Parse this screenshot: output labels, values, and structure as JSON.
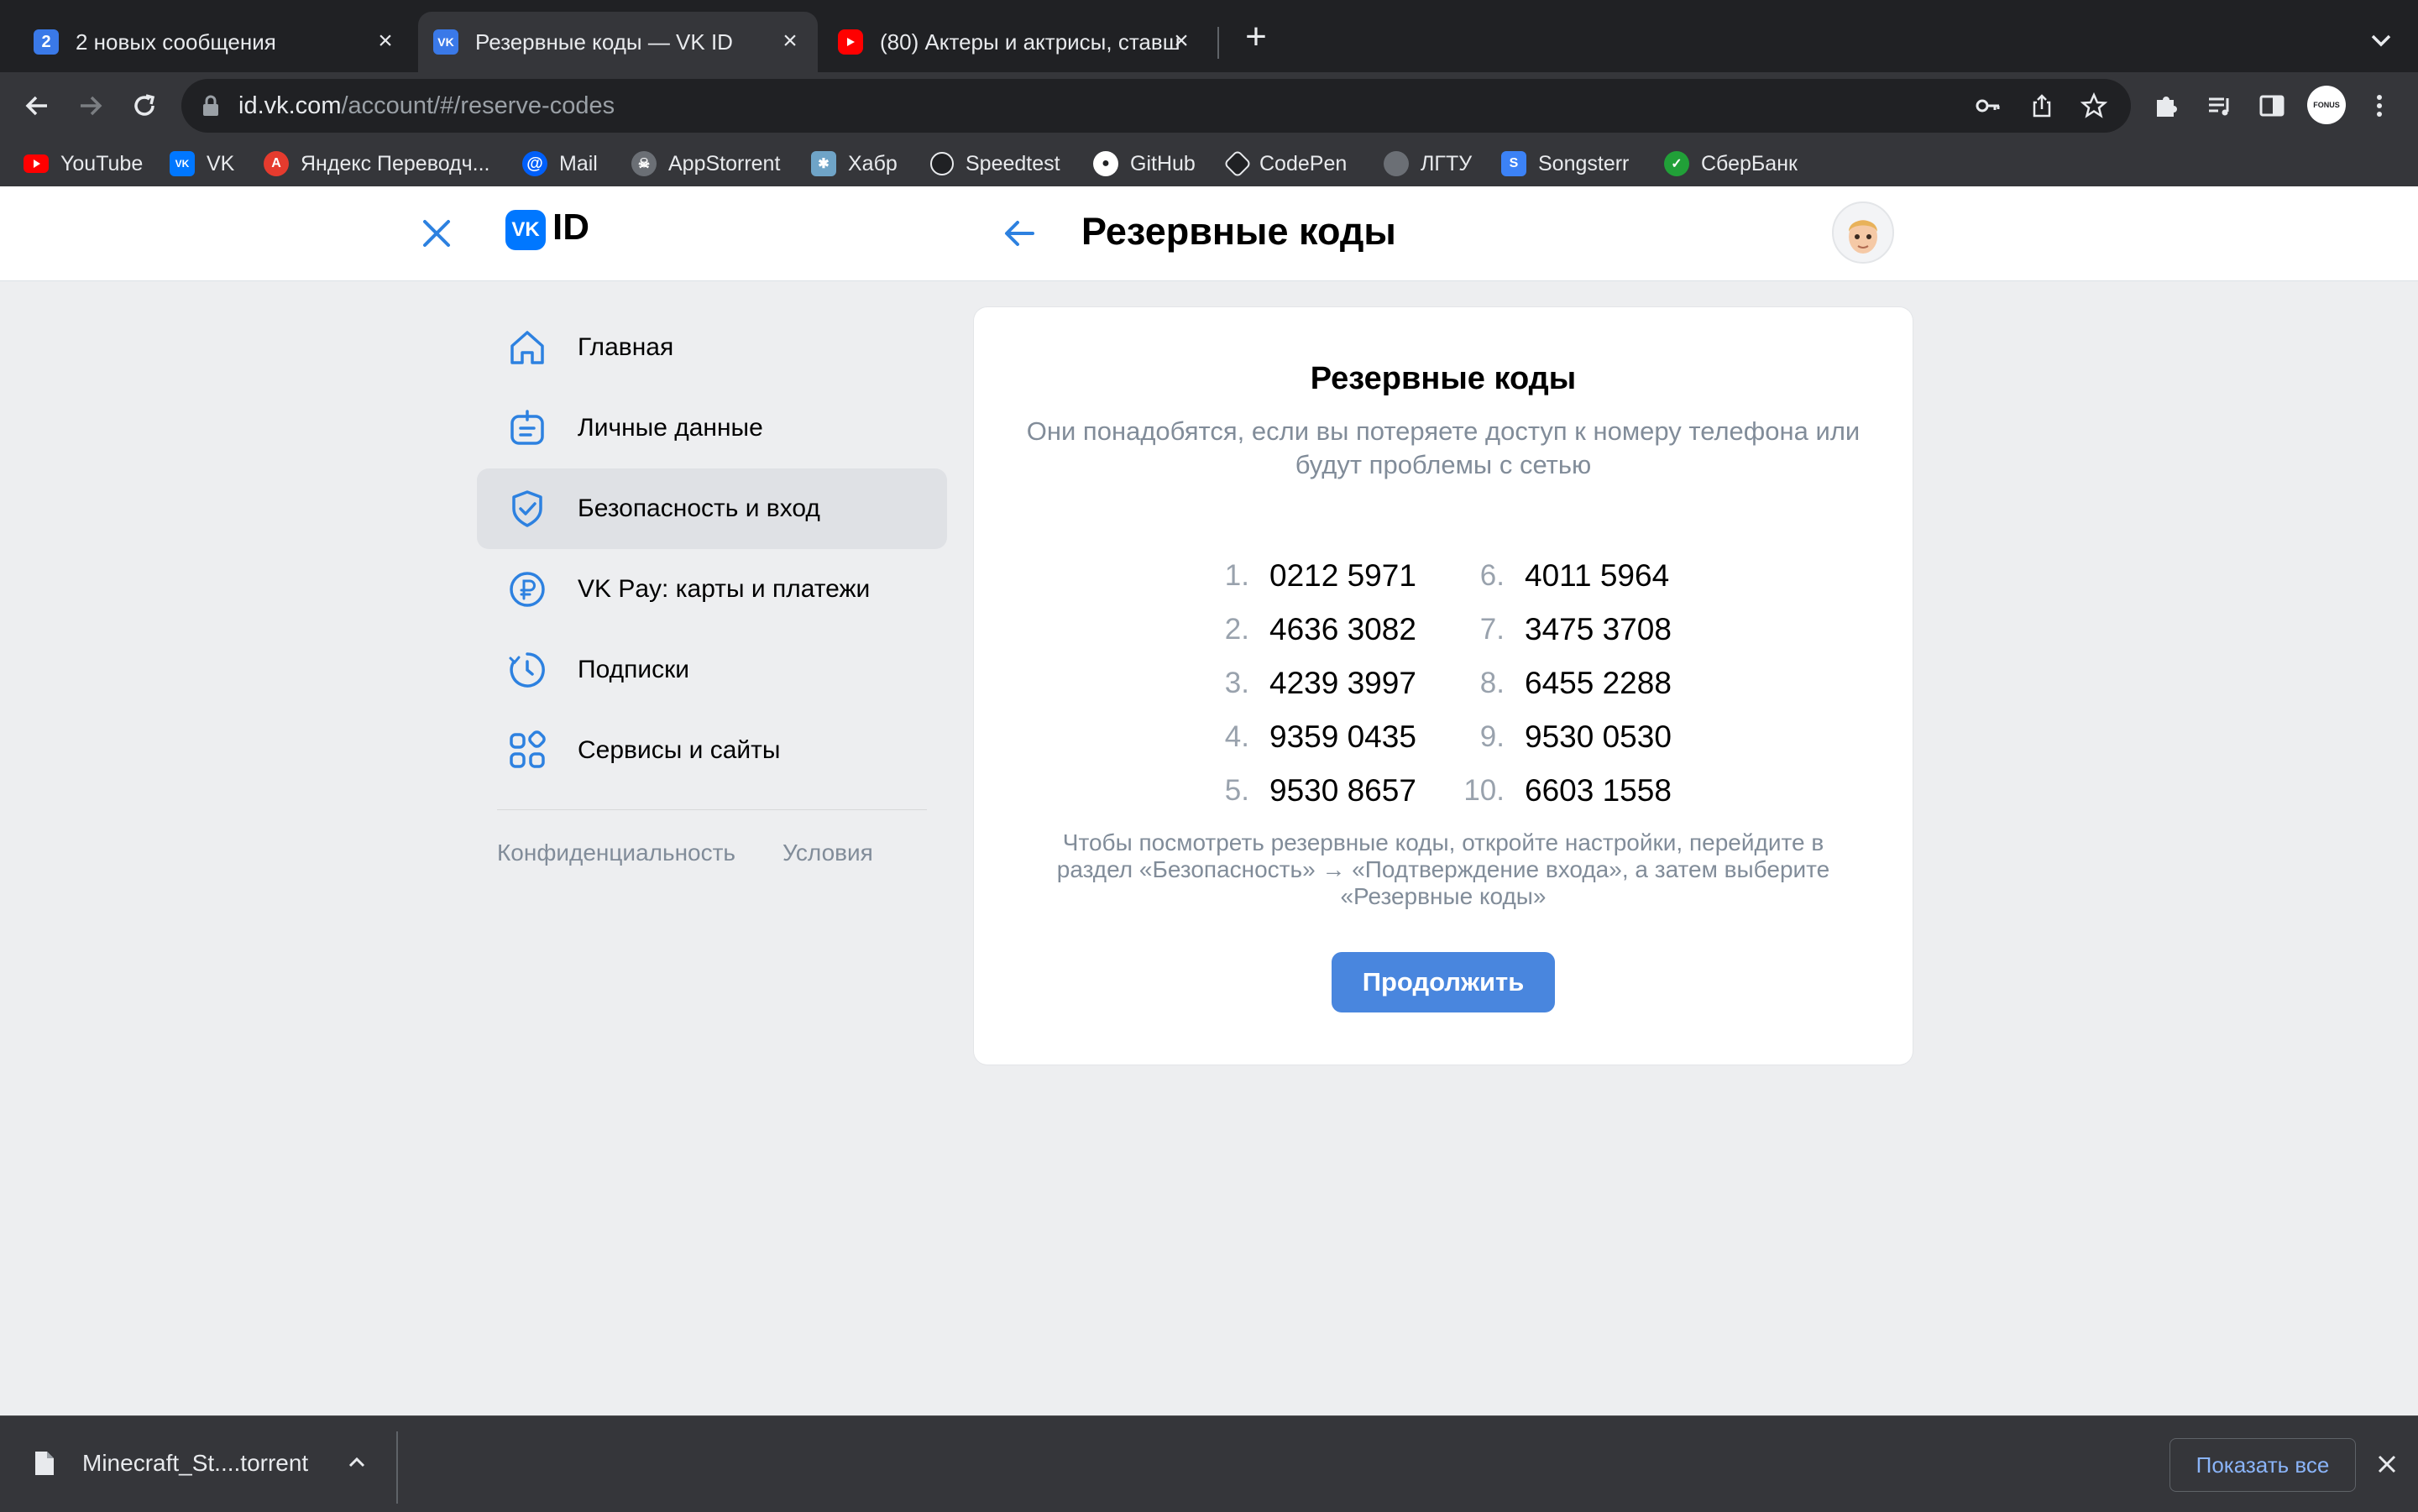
{
  "browser": {
    "tabs": [
      {
        "favicon": "2",
        "title": "2 новых сообщения"
      },
      {
        "favicon": "vk-logo-icon",
        "title": "Резервные коды — VK ID"
      },
      {
        "favicon": "youtube-icon",
        "title": "(80) Актеры и актрисы, ставш"
      }
    ],
    "new_tab": "+",
    "url_host": "id.vk.com",
    "url_path": "/account/#/reserve-codes",
    "profile_label": "FONUS",
    "bookmarks": [
      {
        "label": "YouTube",
        "icon": "youtube-icon",
        "color": "#ff0000"
      },
      {
        "label": "VK",
        "icon": "vk-icon",
        "color": "#0077ff"
      },
      {
        "label": "Яндекс Переводч...",
        "icon": "yandex-translate-icon",
        "color": "#e63b2e"
      },
      {
        "label": "Mail",
        "icon": "mail-icon",
        "color": "#005ff9"
      },
      {
        "label": "AppStorrent",
        "icon": "appstorrent-icon",
        "color": "#6b6f75"
      },
      {
        "label": "Хабр",
        "icon": "habr-icon",
        "color": "#6fa4c7"
      },
      {
        "label": "Speedtest",
        "icon": "speedtest-icon",
        "color": "#202124"
      },
      {
        "label": "GitHub",
        "icon": "github-icon",
        "color": "#ffffff"
      },
      {
        "label": "CodePen",
        "icon": "codepen-icon",
        "color": "#202124"
      },
      {
        "label": "ЛГТУ",
        "icon": "globe-icon",
        "color": "#6b6f75"
      },
      {
        "label": "Songsterr",
        "icon": "songsterr-icon",
        "color": "#3c82f6"
      },
      {
        "label": "СберБанк",
        "icon": "sberbank-icon",
        "color": "#21a038"
      }
    ]
  },
  "vk": {
    "logo_text": "ID",
    "page_title": "Резервные коды",
    "menu": [
      {
        "label": "Главная",
        "icon": "home-icon"
      },
      {
        "label": "Личные данные",
        "icon": "personal-data-icon"
      },
      {
        "label": "Безопасность и вход",
        "icon": "shield-icon",
        "active": true
      },
      {
        "label": "VK Pay: карты и платежи",
        "icon": "ruble-icon"
      },
      {
        "label": "Подписки",
        "icon": "subscriptions-icon"
      },
      {
        "label": "Сервисы и сайты",
        "icon": "services-icon"
      }
    ],
    "footer_links": [
      "Конфиденциальность",
      "Условия"
    ],
    "card": {
      "title": "Резервные коды",
      "subtitle": "Они понадобятся, если вы потеряете доступ к номеру телефона или будут проблемы с сетью",
      "codes": [
        {
          "n": "1.",
          "code": "0212 5971"
        },
        {
          "n": "2.",
          "code": "4636 3082"
        },
        {
          "n": "3.",
          "code": "4239 3997"
        },
        {
          "n": "4.",
          "code": "9359 0435"
        },
        {
          "n": "5.",
          "code": "9530 8657"
        },
        {
          "n": "6.",
          "code": "4011 5964"
        },
        {
          "n": "7.",
          "code": "3475 3708"
        },
        {
          "n": "8.",
          "code": "6455 2288"
        },
        {
          "n": "9.",
          "code": "9530 0530"
        },
        {
          "n": "10.",
          "code": "6603 1558"
        }
      ],
      "note": "Чтобы посмотреть резервные коды, откройте настройки, перейдите в раздел «Безопасность» → «Подтверждение входа», а затем выберите «Резервные коды»",
      "button": "Продолжить"
    },
    "accent_color": "#0077ff"
  },
  "downloads": {
    "file": "Minecraft_St....torrent",
    "show_all": "Показать все"
  }
}
